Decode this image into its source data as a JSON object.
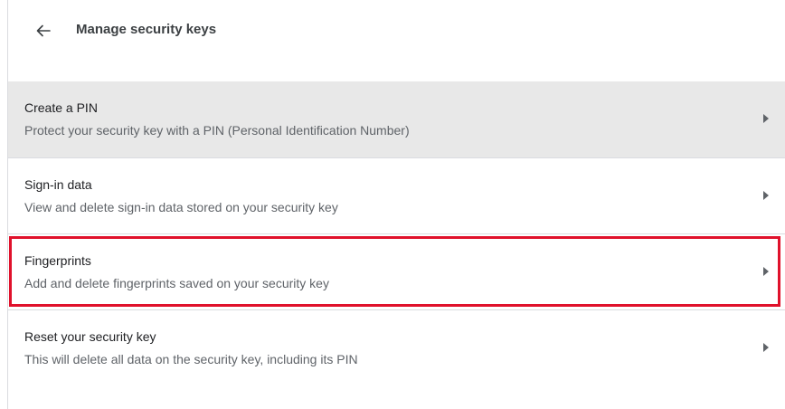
{
  "header": {
    "back_icon": "arrow-left-icon",
    "title": "Manage security keys"
  },
  "rows": [
    {
      "title": "Create a PIN",
      "subtitle": "Protect your security key with a PIN (Personal Identification Number)",
      "icon": "caret-right-icon"
    },
    {
      "title": "Sign-in data",
      "subtitle": "View and delete sign-in data stored on your security key",
      "icon": "caret-right-icon"
    },
    {
      "title": "Fingerprints",
      "subtitle": "Add and delete fingerprints saved on your security key",
      "icon": "caret-right-icon"
    },
    {
      "title": "Reset your security key",
      "subtitle": "This will delete all data on the security key, including its PIN",
      "icon": "caret-right-icon"
    }
  ],
  "colors": {
    "highlight_border": "#e0112b",
    "hover_row_bg": "#e8e8e8"
  }
}
